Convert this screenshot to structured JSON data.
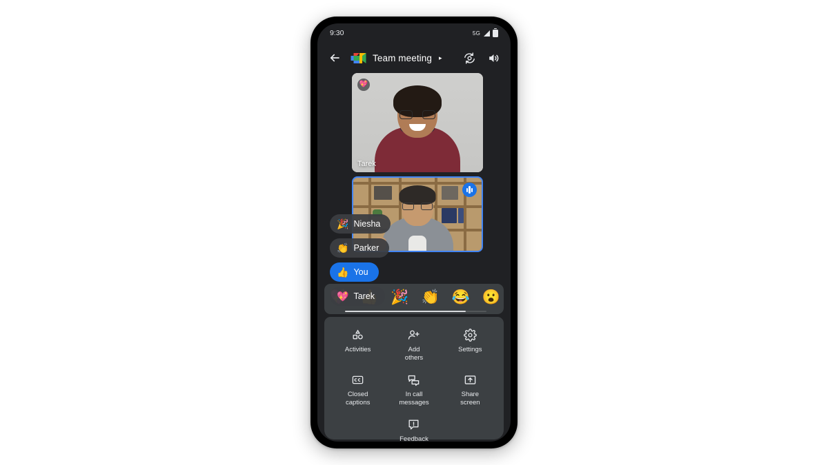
{
  "status_bar": {
    "time": "9:30",
    "network_label": "5G",
    "signal_icon": "signal-bars-icon",
    "battery_icon": "battery-icon"
  },
  "app_bar": {
    "back_icon": "back-arrow-icon",
    "logo_icon": "google-meet-logo-icon",
    "title": "Team meeting",
    "title_caret": "▸",
    "switch_camera_icon": "switch-camera-icon",
    "speaker_icon": "speaker-volume-icon"
  },
  "video_tiles": [
    {
      "participant": "Tarek",
      "name_label": "Tarek",
      "reaction_badge_emoji": "💖",
      "reaction_badge_name": "sparkling-heart-reaction-badge",
      "active_speaker": false
    },
    {
      "participant": "Parker",
      "name_label": "",
      "audio_indicator_name": "audio-level-indicator",
      "active_speaker": true,
      "highlight_color": "#4285f4"
    }
  ],
  "reaction_chips": [
    {
      "emoji": "🎉",
      "name": "Niesha",
      "self": false
    },
    {
      "emoji": "👏",
      "name": "Parker",
      "self": false
    },
    {
      "emoji": "👍",
      "name": "You",
      "self": true
    },
    {
      "emoji": "💖",
      "name": "Tarek",
      "self": false
    }
  ],
  "emoji_picker": {
    "emojis": [
      "💖",
      "👍",
      "🎉",
      "👏",
      "😂",
      "😮",
      "👏"
    ],
    "scrollbar_name": "emoji-row-scrollbar"
  },
  "menu": {
    "items": [
      {
        "label": "Activities",
        "icon": "activities-shapes-icon"
      },
      {
        "label": "Add\nothers",
        "icon": "add-person-icon"
      },
      {
        "label": "Settings",
        "icon": "gear-icon"
      },
      {
        "label": "Closed\ncaptions",
        "icon": "closed-captions-icon"
      },
      {
        "label": "In call\nmessages",
        "icon": "chat-bubbles-icon"
      },
      {
        "label": "Share\nscreen",
        "icon": "share-screen-icon"
      },
      {
        "label": "Feedback",
        "icon": "feedback-icon"
      }
    ]
  },
  "colors": {
    "accent_blue": "#1a73e8",
    "highlight_blue": "#4285f4",
    "screen_bg": "#202124",
    "panel_bg": "#3c4043",
    "text_primary": "#e8eaed"
  }
}
